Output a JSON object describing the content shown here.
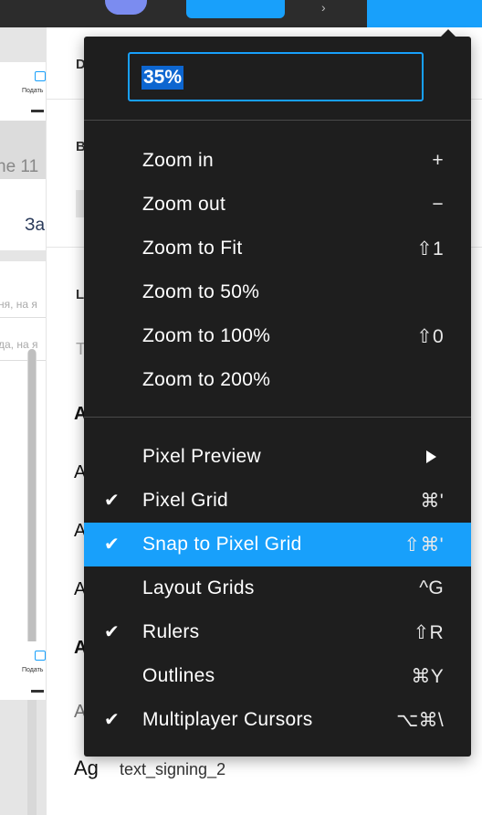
{
  "canvas": {
    "frame_label_1": "Подать",
    "frame_heading_fragment": "ne 11",
    "tab_fragment": "За",
    "list_text_1": "ня, на я",
    "list_text_2": "да, на я",
    "frame_label_2": "Подать"
  },
  "panel": {
    "section_1_initial": "D",
    "section_2_initial": "B",
    "section_3_initial": "L",
    "type_placeholder": "T",
    "sample_glyph": "A",
    "bottom_glyph": "Ag",
    "bottom_style_name": "text_signing_2"
  },
  "zoom_menu": {
    "input_value": "35%",
    "groups": [
      [
        {
          "label": "Zoom in",
          "shortcut": "+"
        },
        {
          "label": "Zoom out",
          "shortcut": "−"
        },
        {
          "label": "Zoom to Fit",
          "shortcut": "⇧1"
        },
        {
          "label": "Zoom to 50%",
          "shortcut": ""
        },
        {
          "label": "Zoom to 100%",
          "shortcut": "⇧0"
        },
        {
          "label": "Zoom to 200%",
          "shortcut": ""
        }
      ],
      [
        {
          "label": "Pixel Preview",
          "shortcut": "",
          "submenu": true
        },
        {
          "label": "Pixel Grid",
          "shortcut": "⌘'",
          "checked": true
        },
        {
          "label": "Snap to Pixel Grid",
          "shortcut": "⇧⌘'",
          "checked": true,
          "highlighted": true
        },
        {
          "label": "Layout Grids",
          "shortcut": "^G"
        },
        {
          "label": "Rulers",
          "shortcut": "⇧R",
          "checked": true
        },
        {
          "label": "Outlines",
          "shortcut": "⌘Y"
        },
        {
          "label": "Multiplayer Cursors",
          "shortcut": "⌥⌘\\",
          "checked": true
        }
      ]
    ],
    "check_glyph": "✔"
  },
  "colors": {
    "accent": "#18a0fb",
    "menu_bg": "#1e1e1e",
    "selection": "#0d66d0"
  }
}
